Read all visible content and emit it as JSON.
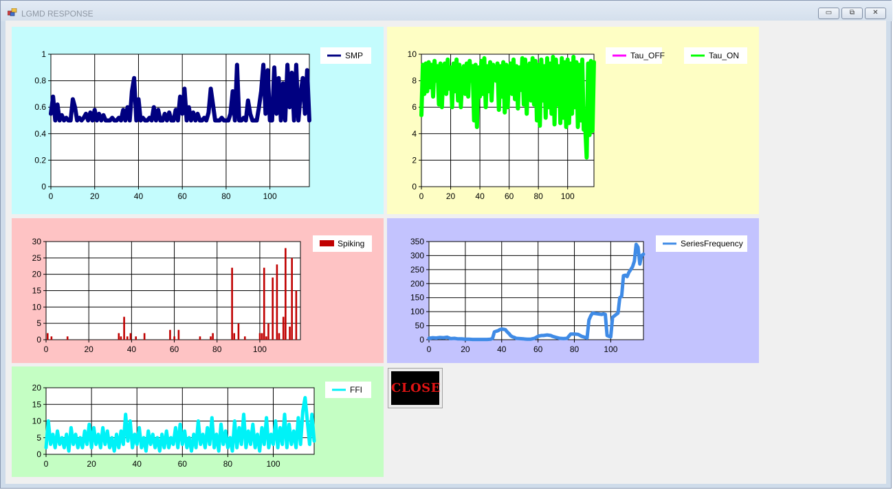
{
  "window": {
    "title": "LGMD RESPONSE",
    "buttons": {
      "minimize": "▭",
      "maximize": "⧉",
      "close": "✕"
    }
  },
  "close_button": {
    "label": "CLOSE",
    "bg": "#000000",
    "fg": "#e11414"
  },
  "chart_data": [
    {
      "type": "line",
      "x": [
        0,
        1,
        2,
        3,
        4,
        5,
        6,
        7,
        8,
        9,
        10,
        11,
        12,
        13,
        14,
        15,
        16,
        17,
        18,
        19,
        20,
        21,
        22,
        23,
        24,
        25,
        26,
        27,
        28,
        29,
        30,
        31,
        32,
        33,
        34,
        35,
        36,
        37,
        38,
        39,
        40,
        41,
        42,
        43,
        44,
        45,
        46,
        47,
        48,
        49,
        50,
        51,
        52,
        53,
        54,
        55,
        56,
        57,
        58,
        59,
        60,
        61,
        62,
        63,
        64,
        65,
        66,
        67,
        68,
        69,
        70,
        71,
        72,
        73,
        74,
        75,
        76,
        77,
        78,
        79,
        80,
        81,
        82,
        83,
        84,
        85,
        86,
        87,
        88,
        89,
        90,
        91,
        92,
        93,
        94,
        95,
        96,
        97,
        98,
        99,
        100,
        101,
        102,
        103,
        104,
        105,
        106,
        107,
        108,
        109,
        110,
        111,
        112,
        113,
        114,
        115,
        116,
        117,
        118
      ],
      "series": [
        {
          "name": "SMP",
          "color": "#000080",
          "values": [
            0.55,
            0.68,
            0.5,
            0.62,
            0.5,
            0.54,
            0.5,
            0.52,
            0.5,
            0.5,
            0.66,
            0.6,
            0.5,
            0.52,
            0.5,
            0.52,
            0.55,
            0.5,
            0.56,
            0.5,
            0.58,
            0.5,
            0.55,
            0.5,
            0.54,
            0.5,
            0.5,
            0.5,
            0.52,
            0.5,
            0.5,
            0.52,
            0.5,
            0.58,
            0.5,
            0.6,
            0.5,
            0.72,
            0.82,
            0.5,
            0.66,
            0.5,
            0.52,
            0.5,
            0.5,
            0.52,
            0.5,
            0.6,
            0.5,
            0.58,
            0.5,
            0.5,
            0.55,
            0.5,
            0.56,
            0.5,
            0.5,
            0.58,
            0.5,
            0.68,
            0.55,
            0.74,
            0.5,
            0.6,
            0.5,
            0.56,
            0.5,
            0.55,
            0.5,
            0.5,
            0.52,
            0.5,
            0.56,
            0.74,
            0.62,
            0.5,
            0.5,
            0.5,
            0.52,
            0.5,
            0.5,
            0.5,
            0.55,
            0.72,
            0.5,
            0.92,
            0.5,
            0.5,
            0.52,
            0.5,
            0.65,
            0.55,
            0.5,
            0.5,
            0.5,
            0.6,
            0.72,
            0.92,
            0.55,
            0.88,
            0.5,
            0.5,
            0.9,
            0.55,
            0.82,
            0.5,
            0.78,
            0.5,
            0.92,
            0.6,
            0.86,
            0.5,
            0.92,
            0.5,
            0.7,
            0.82,
            0.55,
            0.88,
            0.5
          ]
        }
      ],
      "xlim": [
        0,
        118
      ],
      "ylim": [
        0,
        1
      ],
      "xticks": [
        "0",
        "20",
        "40",
        "60",
        "80",
        "100"
      ],
      "yticks": [
        "0",
        "0.2",
        "0.4",
        "0.6",
        "0.8",
        "1"
      ],
      "legend": "top-right",
      "grid": true,
      "background": "#c4fcfd"
    },
    {
      "type": "line",
      "x": [
        0,
        1,
        2,
        3,
        4,
        5,
        6,
        7,
        8,
        9,
        10,
        11,
        12,
        13,
        14,
        15,
        16,
        17,
        18,
        19,
        20,
        21,
        22,
        23,
        24,
        25,
        26,
        27,
        28,
        29,
        30,
        31,
        32,
        33,
        34,
        35,
        36,
        37,
        38,
        39,
        40,
        41,
        42,
        43,
        44,
        45,
        46,
        47,
        48,
        49,
        50,
        51,
        52,
        53,
        54,
        55,
        56,
        57,
        58,
        59,
        60,
        61,
        62,
        63,
        64,
        65,
        66,
        67,
        68,
        69,
        70,
        71,
        72,
        73,
        74,
        75,
        76,
        77,
        78,
        79,
        80,
        81,
        82,
        83,
        84,
        85,
        86,
        87,
        88,
        89,
        90,
        91,
        92,
        93,
        94,
        95,
        96,
        97,
        98,
        99,
        100,
        101,
        102,
        103,
        104,
        105,
        106,
        107,
        108,
        109,
        110,
        111,
        112,
        113,
        114,
        115,
        116,
        117,
        118
      ],
      "series": [
        {
          "name": "Tau_OFF",
          "color": "#ff00ff",
          "values": []
        },
        {
          "name": "Tau_ON",
          "color": "#00ff00",
          "values": [
            5.4,
            9.2,
            7,
            9.3,
            7.2,
            9.4,
            7.5,
            9.2,
            6.8,
            9.5,
            8,
            9.1,
            6.2,
            9.3,
            6,
            8.8,
            9.3,
            7,
            9.6,
            7.4,
            9,
            6,
            9.3,
            7.2,
            9.6,
            6.5,
            9.2,
            6,
            8.5,
            9.1,
            7,
            9.3,
            6.8,
            9.5,
            8,
            9.1,
            5,
            9.2,
            4.5,
            9,
            6.8,
            9.5,
            7,
            9.7,
            6,
            9.1,
            7.2,
            9.4,
            6.5,
            9.2,
            8.6,
            8,
            9.3,
            5.8,
            9.1,
            6.8,
            9.4,
            5.6,
            9.2,
            6,
            8.5,
            9.3,
            7,
            9.6,
            6.6,
            9.1,
            5.9,
            9,
            7.3,
            9.7,
            6.2,
            9.6,
            5.5,
            8.8,
            9.3,
            6.5,
            9.7,
            6.2,
            9.5,
            5,
            9.2,
            4.6,
            9.6,
            6.5,
            9.1,
            5.2,
            9.7,
            6,
            9.3,
            5.5,
            9.8,
            4.7,
            9.6,
            6.2,
            9.1,
            4.8,
            9.7,
            5.2,
            9.4,
            4.5,
            9.6,
            4.8,
            9.3,
            5.5,
            9.8,
            6,
            9.4,
            4.5,
            9.2,
            5,
            9.6,
            4.3,
            4.6,
            2.2,
            9.3,
            3.9,
            9.5,
            4.2,
            9.4
          ]
        }
      ],
      "xlim": [
        0,
        118
      ],
      "ylim": [
        0,
        10
      ],
      "xticks": [
        "0",
        "20",
        "40",
        "60",
        "80",
        "100"
      ],
      "yticks": [
        "0",
        "2",
        "4",
        "6",
        "8",
        "10"
      ],
      "legend": "top-right",
      "grid": true,
      "background": "#fefec4"
    },
    {
      "type": "bar",
      "x": [
        1,
        4,
        14,
        50,
        52,
        54,
        56,
        58,
        62,
        68,
        76,
        79,
        82,
        94,
        104,
        105,
        109,
        110,
        112,
        116,
        120,
        121,
        122,
        123,
        124,
        126,
        128,
        129,
        131,
        132,
        134,
        135,
        136
      ],
      "series": [
        {
          "name": "Spiking",
          "color": "#c00000",
          "values": [
            2,
            1,
            1,
            2,
            1,
            7,
            1,
            2,
            1,
            2,
            3,
            1,
            3,
            1,
            1,
            2,
            22,
            2,
            5,
            1,
            2,
            2,
            22,
            1,
            5,
            19,
            23,
            2,
            7,
            28,
            4,
            25,
            15
          ]
        }
      ],
      "note_x": [
        0,
        1,
        2,
        3,
        4,
        5,
        6,
        7,
        8,
        9,
        10,
        11,
        12,
        13,
        14,
        15,
        16,
        17,
        18,
        19,
        20,
        21,
        22,
        23,
        24,
        25,
        26,
        27,
        28,
        29,
        30,
        31,
        32
      ],
      "bar_x": [
        0.7,
        2.5,
        10,
        34,
        35,
        36.5,
        38,
        39.5,
        42,
        46,
        58,
        60,
        62,
        72,
        77,
        78,
        87,
        88,
        90,
        93,
        100,
        101,
        102,
        103,
        104,
        106,
        108,
        109,
        111,
        112,
        114,
        115,
        117
      ],
      "xlim": [
        0,
        119
      ],
      "ylim": [
        0,
        30
      ],
      "xticks": [
        "0",
        "20",
        "40",
        "60",
        "80",
        "100"
      ],
      "yticks": [
        "0",
        "5",
        "10",
        "15",
        "20",
        "25",
        "30"
      ],
      "legend": "top-right",
      "grid": true,
      "background": "#fec3c4"
    },
    {
      "type": "line",
      "x": [
        0,
        2,
        4,
        6,
        8,
        10,
        12,
        14,
        16,
        18,
        20,
        22,
        24,
        26,
        28,
        30,
        32,
        34,
        35,
        36,
        37,
        38,
        39,
        40,
        41,
        42,
        43,
        44,
        45,
        46,
        47,
        48,
        50,
        52,
        54,
        56,
        58,
        60,
        61,
        62,
        63,
        64,
        65,
        66,
        67,
        68,
        69,
        70,
        72,
        74,
        76,
        78,
        80,
        82,
        84,
        86,
        87,
        88,
        89,
        90,
        91,
        92,
        93,
        94,
        95,
        96,
        97,
        98,
        99,
        100,
        101,
        102,
        103,
        104,
        105,
        106,
        107,
        108,
        109,
        110,
        111,
        112,
        113,
        114,
        115,
        116,
        117,
        118
      ],
      "series": [
        {
          "name": "SeriesFrequency",
          "color": "#3f8be6",
          "values": [
            5,
            7,
            6,
            8,
            7,
            9,
            4,
            5,
            3,
            3,
            2,
            2,
            1,
            1,
            1,
            1,
            1,
            2,
            5,
            28,
            30,
            32,
            36,
            38,
            37,
            36,
            28,
            22,
            14,
            10,
            8,
            5,
            4,
            3,
            2,
            2,
            5,
            12,
            14,
            15,
            15,
            16,
            17,
            16,
            15,
            12,
            10,
            8,
            5,
            4,
            5,
            20,
            20,
            19,
            12,
            8,
            6,
            70,
            85,
            95,
            94,
            93,
            92,
            91,
            90,
            92,
            90,
            15,
            12,
            10,
            80,
            85,
            90,
            95,
            150,
            155,
            228,
            230,
            225,
            240,
            250,
            260,
            280,
            340,
            330,
            270,
            300,
            305
          ]
        }
      ],
      "xlim": [
        0,
        118
      ],
      "ylim": [
        0,
        350
      ],
      "xticks": [
        "0",
        "20",
        "40",
        "60",
        "80",
        "100"
      ],
      "yticks": [
        "0",
        "50",
        "100",
        "150",
        "200",
        "250",
        "300",
        "350"
      ],
      "legend": "top-right",
      "grid": true,
      "background": "#c3c3fe"
    },
    {
      "type": "line",
      "x": [
        0,
        1,
        2,
        3,
        4,
        5,
        6,
        7,
        8,
        9,
        10,
        11,
        12,
        13,
        14,
        15,
        16,
        17,
        18,
        19,
        20,
        21,
        22,
        23,
        24,
        25,
        26,
        27,
        28,
        29,
        30,
        31,
        32,
        33,
        34,
        35,
        36,
        37,
        38,
        39,
        40,
        41,
        42,
        43,
        44,
        45,
        46,
        47,
        48,
        49,
        50,
        51,
        52,
        53,
        54,
        55,
        56,
        57,
        58,
        59,
        60,
        61,
        62,
        63,
        64,
        65,
        66,
        67,
        68,
        69,
        70,
        71,
        72,
        73,
        74,
        75,
        76,
        77,
        78,
        79,
        80,
        81,
        82,
        83,
        84,
        85,
        86,
        87,
        88,
        89,
        90,
        91,
        92,
        93,
        94,
        95,
        96,
        97,
        98,
        99,
        100,
        101,
        102,
        103,
        104,
        105,
        106,
        107,
        108,
        109,
        110,
        111,
        112,
        113,
        114,
        115,
        116,
        117,
        118
      ],
      "series": [
        {
          "name": "FFI",
          "color": "#00f2f7",
          "values": [
            2,
            10,
            3,
            6,
            2,
            7,
            3,
            5,
            2,
            6,
            1,
            8,
            3,
            6,
            2,
            5,
            2,
            7,
            3,
            9,
            2,
            8,
            3,
            6,
            2,
            8,
            3,
            7,
            2,
            5,
            1,
            6,
            2,
            7,
            3,
            12,
            4,
            10,
            2,
            6,
            3,
            8,
            2,
            5,
            1,
            7,
            3,
            6,
            2,
            5,
            1,
            6,
            2,
            7,
            2,
            5,
            3,
            8,
            2,
            9,
            3,
            7,
            2,
            5,
            1,
            6,
            2,
            10,
            3,
            6,
            2,
            8,
            3,
            11,
            2,
            6,
            1,
            9,
            3,
            7,
            2,
            5,
            1,
            10,
            2,
            8,
            3,
            12,
            2,
            7,
            3,
            9,
            2,
            6,
            1,
            8,
            3,
            11,
            2,
            6,
            3,
            10,
            2,
            8,
            3,
            12,
            2,
            9,
            3,
            7,
            2,
            11,
            3,
            13,
            17,
            10,
            3,
            12,
            4
          ]
        }
      ],
      "xlim": [
        0,
        118
      ],
      "ylim": [
        0,
        20
      ],
      "xticks": [
        "0",
        "20",
        "40",
        "60",
        "80",
        "100"
      ],
      "yticks": [
        "0",
        "5",
        "10",
        "15",
        "20"
      ],
      "legend": "top-right",
      "grid": true,
      "background": "#c4fec3"
    }
  ]
}
